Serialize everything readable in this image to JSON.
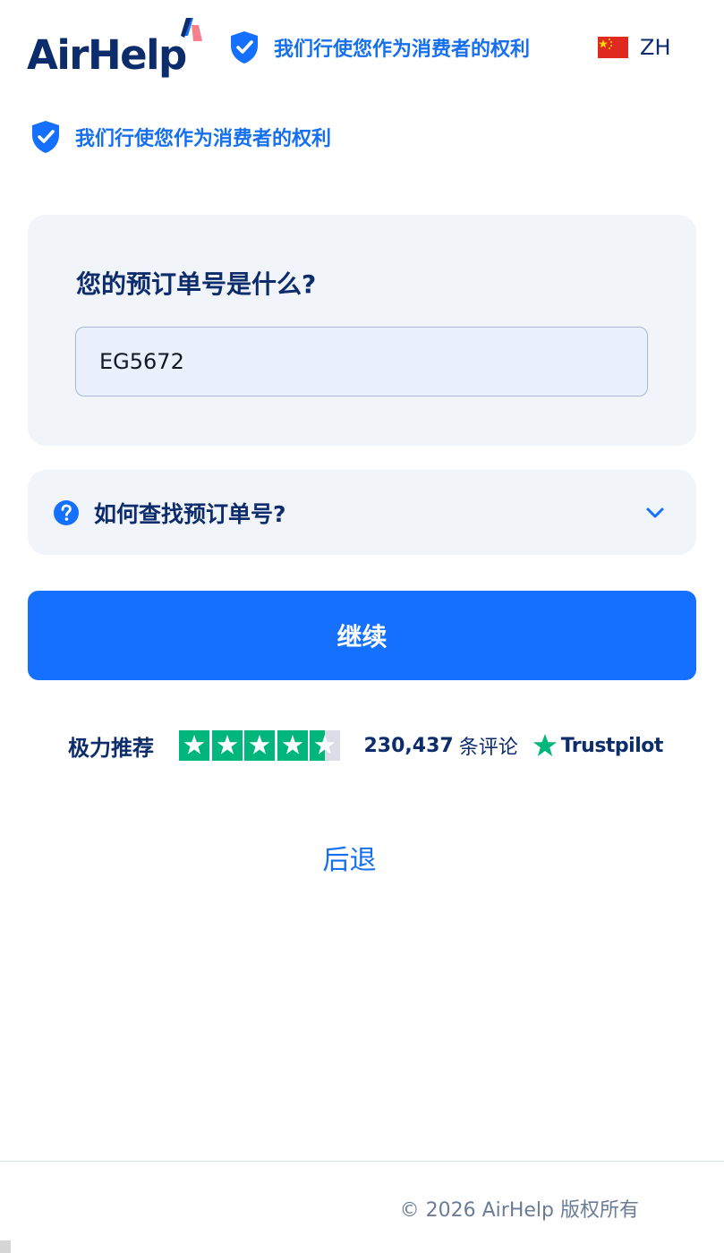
{
  "header": {
    "logo_text": "AirHelp",
    "rights_text": "我们行使您作为消费者的权利",
    "language": "ZH"
  },
  "rights_row": {
    "text": "我们行使您作为消费者的权利"
  },
  "booking_card": {
    "title": "您的预订单号是什么?",
    "input_value": "EG5672"
  },
  "help_accordion": {
    "label": "如何查找预订单号?"
  },
  "continue_button": {
    "label": "继续"
  },
  "trustpilot": {
    "rating_label": "极力推荐",
    "star_rating": 4.5,
    "review_count": "230,437",
    "review_suffix": "条评论",
    "brand": "Trustpilot",
    "star_color": "#00b67a"
  },
  "back_link": {
    "label": "后退"
  },
  "footer": {
    "copyright": "© 2026 AirHelp 版权所有"
  },
  "colors": {
    "brand_navy": "#0c2c6b",
    "accent_blue": "#1570ff",
    "card_bg": "#f1f4f9"
  }
}
